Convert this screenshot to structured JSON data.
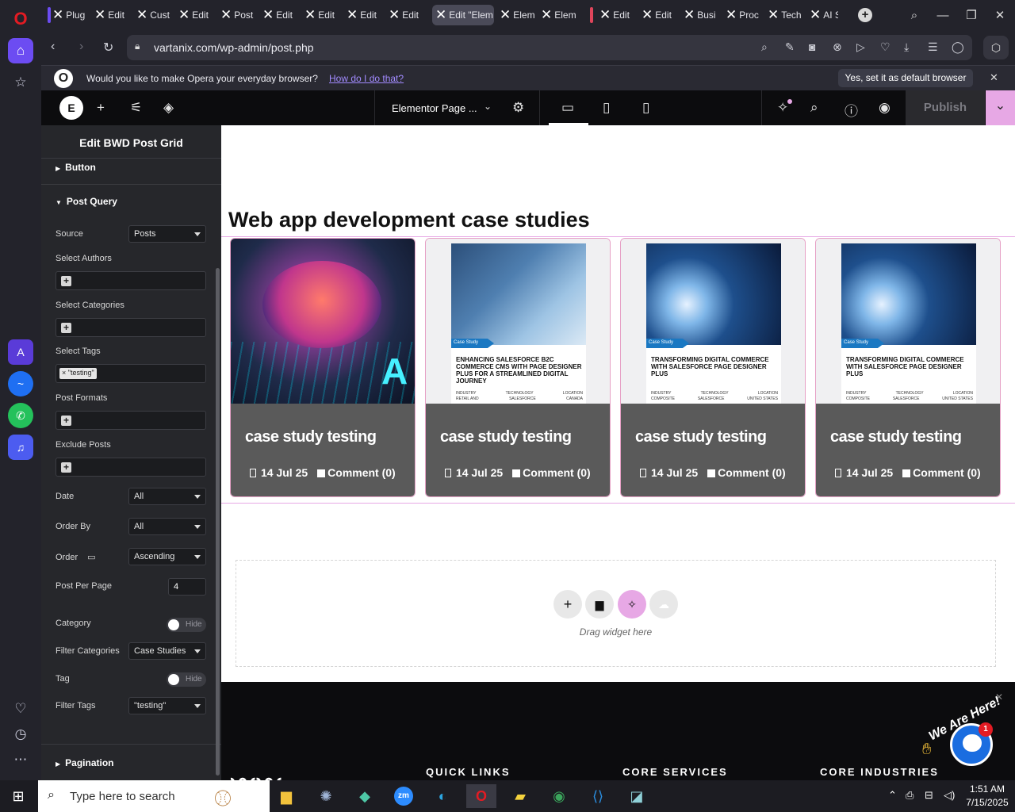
{
  "browser": {
    "tabs": [
      {
        "label": "Plug"
      },
      {
        "label": "Edit"
      },
      {
        "label": "Cust"
      },
      {
        "label": "Edit"
      },
      {
        "label": "Post"
      },
      {
        "label": "Edit"
      },
      {
        "label": "Edit"
      },
      {
        "label": "Edit"
      },
      {
        "label": "Edit"
      },
      {
        "label": "Edit \"Elem"
      },
      {
        "label": "Elem"
      },
      {
        "label": "Elem"
      },
      {
        "label": "Edit"
      },
      {
        "label": "Edit"
      },
      {
        "label": "Busi"
      },
      {
        "label": "Proc"
      },
      {
        "label": "Tech"
      },
      {
        "label": "AI S"
      }
    ],
    "url": "vartanix.com/wp-admin/post.php",
    "infobar": {
      "message": "Would you like to make Opera your everyday browser?",
      "link": "How do I do that?",
      "button": "Yes, set it as default browser"
    }
  },
  "elementor": {
    "page_title": "Elementor Page ...",
    "publish": "Publish",
    "panel": {
      "title": "Edit BWD Post Grid",
      "sections": {
        "button": "Button",
        "post_query": "Post Query",
        "pagination": "Pagination"
      },
      "controls": {
        "source_label": "Source",
        "source_value": "Posts",
        "authors_label": "Select Authors",
        "categories_label": "Select Categories",
        "tags_label": "Select Tags",
        "tags_value": "× \"testing\"",
        "formats_label": "Post Formats",
        "exclude_label": "Exclude Posts",
        "date_label": "Date",
        "date_value": "All",
        "orderby_label": "Order By",
        "orderby_value": "All",
        "order_label": "Order",
        "order_value": "Ascending",
        "perpage_label": "Post Per Page",
        "perpage_value": "4",
        "category_label": "Category",
        "category_toggle": "Hide",
        "filtercat_label": "Filter Categories",
        "filtercat_value": "Case Studies",
        "tag_label": "Tag",
        "tag_toggle": "Hide",
        "filtertags_label": "Filter Tags",
        "filtertags_value": "\"testing\""
      }
    },
    "canvas": {
      "heading": "Web app development case studies",
      "cards": [
        {
          "title": "case study testing",
          "date": "14 Jul 25",
          "comments": "Comment (0)"
        },
        {
          "title": "case study testing",
          "date": "14 Jul 25",
          "comments": "Comment (0)",
          "doc_badge": "Case Study",
          "doc_title": "ENHANCING SALESFORCE B2C COMMERCE CMS WITH PAGE DESIGNER PLUS FOR A STREAMLINED DIGITAL JOURNEY",
          "doc_cols": [
            "INDUSTRY",
            "TECHNOLOGY",
            "LOCATION"
          ],
          "doc_vals": [
            "RETAIL AND",
            "SALESFORCE",
            "CANADA"
          ]
        },
        {
          "title": "case study testing",
          "date": "14 Jul 25",
          "comments": "Comment (0)",
          "doc_badge": "Case Study",
          "doc_title": "TRANSFORMING DIGITAL COMMERCE WITH SALESFORCE PAGE DESIGNER PLUS",
          "doc_cols": [
            "INDUSTRY",
            "TECHNOLOGY",
            "LOCATION"
          ],
          "doc_vals": [
            "COMPOSITE",
            "SALESFORCE",
            "UNITED STATES"
          ]
        },
        {
          "title": "case study testing",
          "date": "14 Jul 25",
          "comments": "Comment (0)",
          "doc_badge": "Case Study",
          "doc_title": "TRANSFORMING DIGITAL COMMERCE WITH SALESFORCE PAGE DESIGNER PLUS",
          "doc_cols": [
            "INDUSTRY",
            "TECHNOLOGY",
            "LOCATION"
          ],
          "doc_vals": [
            "COMPOSITE",
            "SALESFORCE",
            "UNITED STATES"
          ]
        }
      ],
      "drop_hint": "Drag widget here"
    },
    "footer": {
      "quick_links": "QUICK LINKS",
      "core_services": "CORE SERVICES",
      "core_industries": "CORE INDUSTRIES",
      "chat_badge": "1",
      "chat_text": "We Are Here!"
    }
  },
  "taskbar": {
    "search_placeholder": "Type here to search",
    "time": "1:51 AM",
    "date": "7/15/2025"
  },
  "colors": {
    "opera_red": "#e31b23",
    "accent_pink": "#e7a8e5",
    "card_footer": "#5a5a5a",
    "card_border": "#e6a1c6",
    "chat_blue": "#1a6de0"
  }
}
